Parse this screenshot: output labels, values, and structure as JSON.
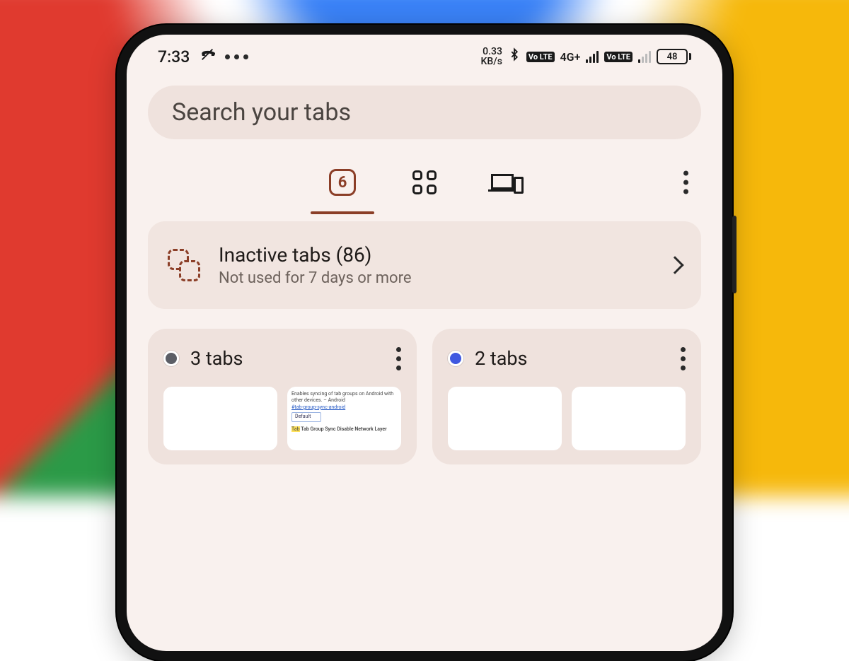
{
  "status": {
    "time": "7:33",
    "data_rate_value": "0.33",
    "data_rate_unit": "KB/s",
    "volte_badge": "Vo LTE",
    "net_label": "4G+",
    "battery_percent": "48"
  },
  "search": {
    "placeholder": "Search your tabs"
  },
  "tabbar": {
    "open_count": "6"
  },
  "inactive": {
    "title": "Inactive tabs (86)",
    "subtitle": "Not used for 7 days or more"
  },
  "groups": [
    {
      "dot_color": "#5b5e66",
      "title": "3 tabs",
      "preview": {
        "line1": "Enables syncing of tab groups on Android with other devices. – Android",
        "flag": "#tab-group-sync-android",
        "select": "Default",
        "heading": "Tab Group Sync Disable Network Layer"
      }
    },
    {
      "dot_color": "#3f58e0",
      "title": "2 tabs"
    }
  ]
}
